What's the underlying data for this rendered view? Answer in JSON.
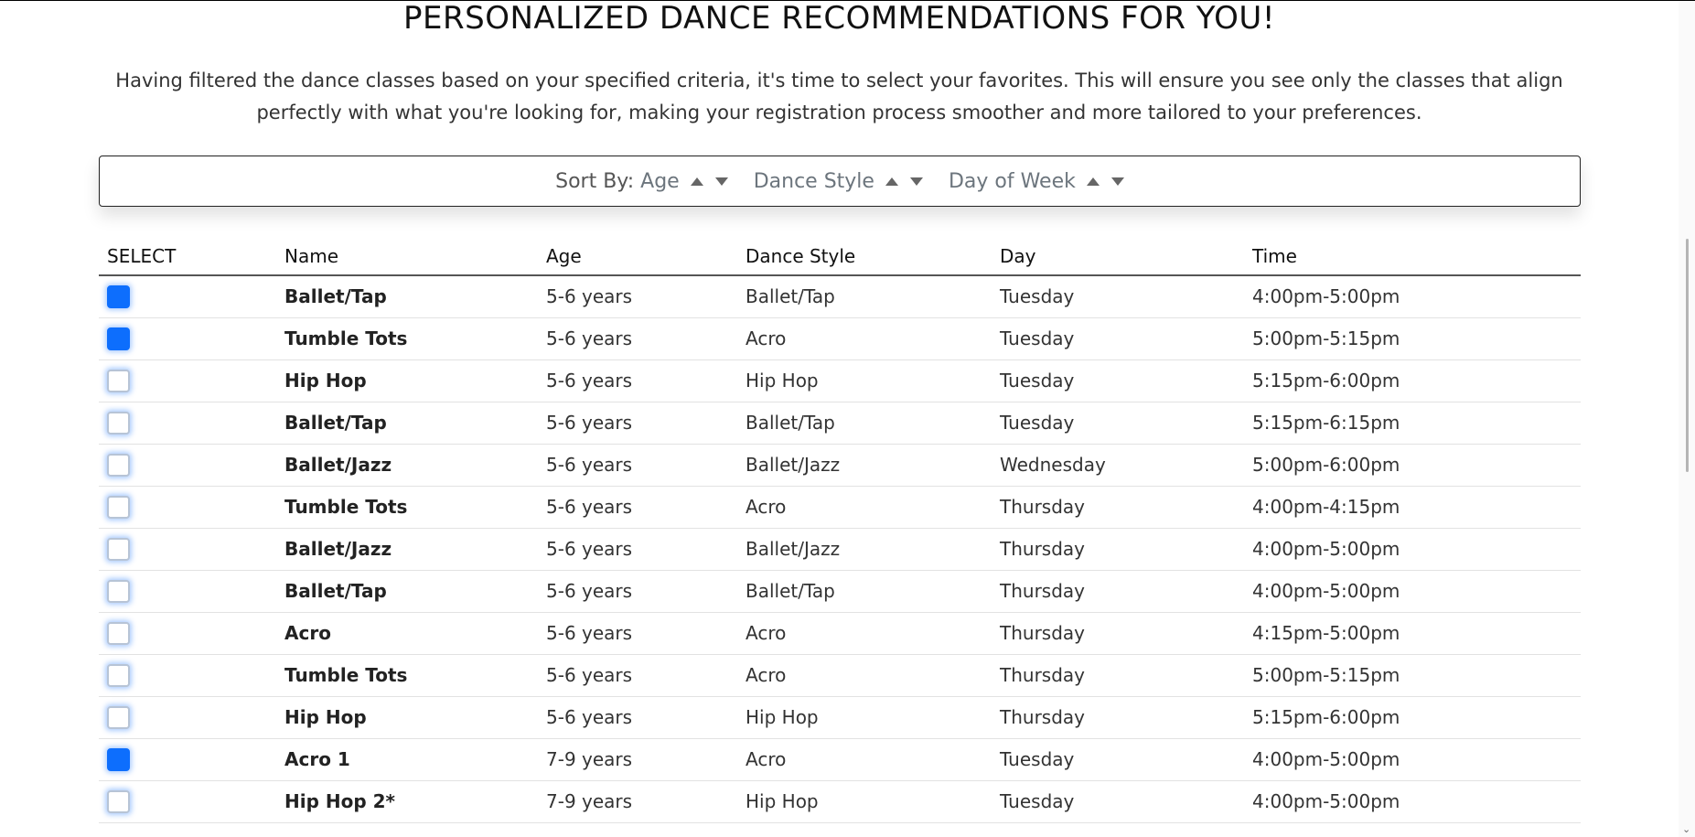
{
  "page": {
    "title": "PERSONALIZED DANCE RECOMMENDATIONS FOR YOU!",
    "intro": "Having filtered the dance classes based on your specified criteria, it's time to select your favorites. This will ensure you see only the classes that align perfectly with what you're looking for, making your registration process smoother and more tailored to your preferences."
  },
  "sort": {
    "label": "Sort By:",
    "options": [
      "Age",
      "Dance Style",
      "Day of Week"
    ]
  },
  "table": {
    "headers": [
      "SELECT",
      "Name",
      "Age",
      "Dance Style",
      "Day",
      "Time"
    ],
    "rows": [
      {
        "selected": true,
        "name": "Ballet/Tap",
        "age": "5-6 years",
        "style": "Ballet/Tap",
        "day": "Tuesday",
        "time": "4:00pm-5:00pm"
      },
      {
        "selected": true,
        "name": "Tumble Tots",
        "age": "5-6 years",
        "style": "Acro",
        "day": "Tuesday",
        "time": "5:00pm-5:15pm"
      },
      {
        "selected": false,
        "name": "Hip Hop",
        "age": "5-6 years",
        "style": "Hip Hop",
        "day": "Tuesday",
        "time": "5:15pm-6:00pm"
      },
      {
        "selected": false,
        "name": "Ballet/Tap",
        "age": "5-6 years",
        "style": "Ballet/Tap",
        "day": "Tuesday",
        "time": "5:15pm-6:15pm"
      },
      {
        "selected": false,
        "name": "Ballet/Jazz",
        "age": "5-6 years",
        "style": "Ballet/Jazz",
        "day": "Wednesday",
        "time": "5:00pm-6:00pm"
      },
      {
        "selected": false,
        "name": "Tumble Tots",
        "age": "5-6 years",
        "style": "Acro",
        "day": "Thursday",
        "time": "4:00pm-4:15pm"
      },
      {
        "selected": false,
        "name": "Ballet/Jazz",
        "age": "5-6 years",
        "style": "Ballet/Jazz",
        "day": "Thursday",
        "time": "4:00pm-5:00pm"
      },
      {
        "selected": false,
        "name": "Ballet/Tap",
        "age": "5-6 years",
        "style": "Ballet/Tap",
        "day": "Thursday",
        "time": "4:00pm-5:00pm"
      },
      {
        "selected": false,
        "name": "Acro",
        "age": "5-6 years",
        "style": "Acro",
        "day": "Thursday",
        "time": "4:15pm-5:00pm"
      },
      {
        "selected": false,
        "name": "Tumble Tots",
        "age": "5-6 years",
        "style": "Acro",
        "day": "Thursday",
        "time": "5:00pm-5:15pm"
      },
      {
        "selected": false,
        "name": "Hip Hop",
        "age": "5-6 years",
        "style": "Hip Hop",
        "day": "Thursday",
        "time": "5:15pm-6:00pm"
      },
      {
        "selected": true,
        "name": "Acro 1",
        "age": "7-9 years",
        "style": "Acro",
        "day": "Tuesday",
        "time": "4:00pm-5:00pm"
      },
      {
        "selected": false,
        "name": "Hip Hop 2*",
        "age": "7-9 years",
        "style": "Hip Hop",
        "day": "Tuesday",
        "time": "4:00pm-5:00pm"
      }
    ]
  },
  "colors": {
    "checkbox_checked": "#0d6efd"
  }
}
